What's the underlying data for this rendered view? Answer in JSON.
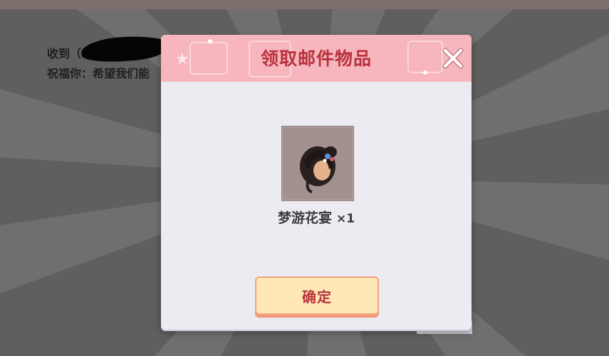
{
  "background": {
    "mail_line_1": "收到（",
    "mail_line_2": "祝福你：希望我们能"
  },
  "dialog": {
    "title": "领取邮件物品",
    "close_icon": "close-x-icon",
    "item": {
      "icon": "hairstyle-item-icon",
      "name": "梦游花宴",
      "quantity": "×1"
    },
    "confirm_label": "确定"
  },
  "colors": {
    "header": "#f7b5bd",
    "title_text": "#b8323e",
    "dialog_body": "#ecebf1",
    "button_fill": "#ffe7b6",
    "button_border": "#f2a37f"
  }
}
